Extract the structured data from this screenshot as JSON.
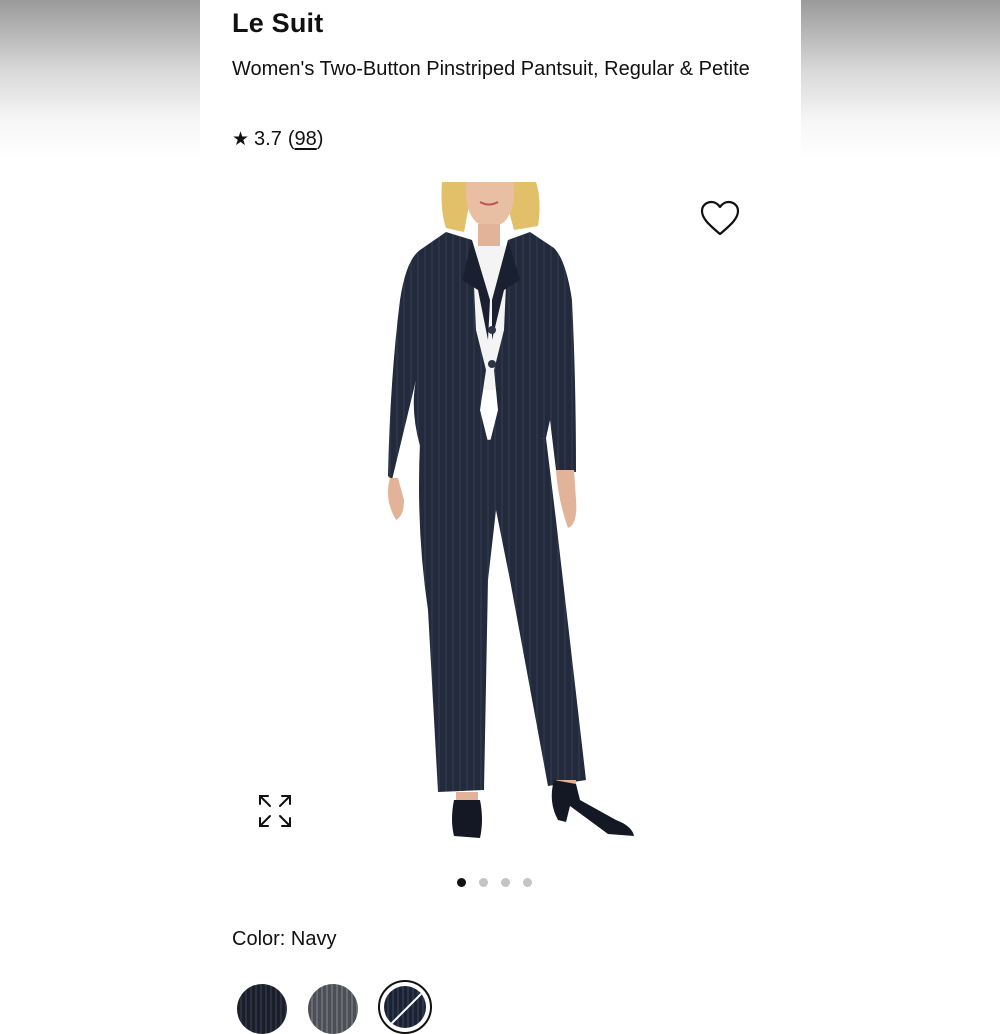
{
  "product": {
    "brand": "Le Suit",
    "title": "Women's Two-Button Pinstriped Pantsuit, Regular & Petite",
    "rating": {
      "star_icon": "★",
      "score": "3.7",
      "open_paren": "(",
      "count": "98",
      "close_paren": ")"
    }
  },
  "gallery": {
    "wishlist_icon": "heart-outline-icon",
    "expand_icon": "expand-arrows-icon",
    "dots": [
      {
        "active": true
      },
      {
        "active": false
      },
      {
        "active": false
      },
      {
        "active": false
      }
    ]
  },
  "color": {
    "label": "Color: Navy",
    "swatches": [
      {
        "color": "#1a1f2a"
      },
      {
        "color": "#5c5e66"
      },
      {
        "color": "#1b2233",
        "selected": true
      }
    ]
  },
  "colors": {
    "suit_navy": "#1f2638",
    "text": "#111111",
    "dot_inactive": "#c4c4c4"
  }
}
